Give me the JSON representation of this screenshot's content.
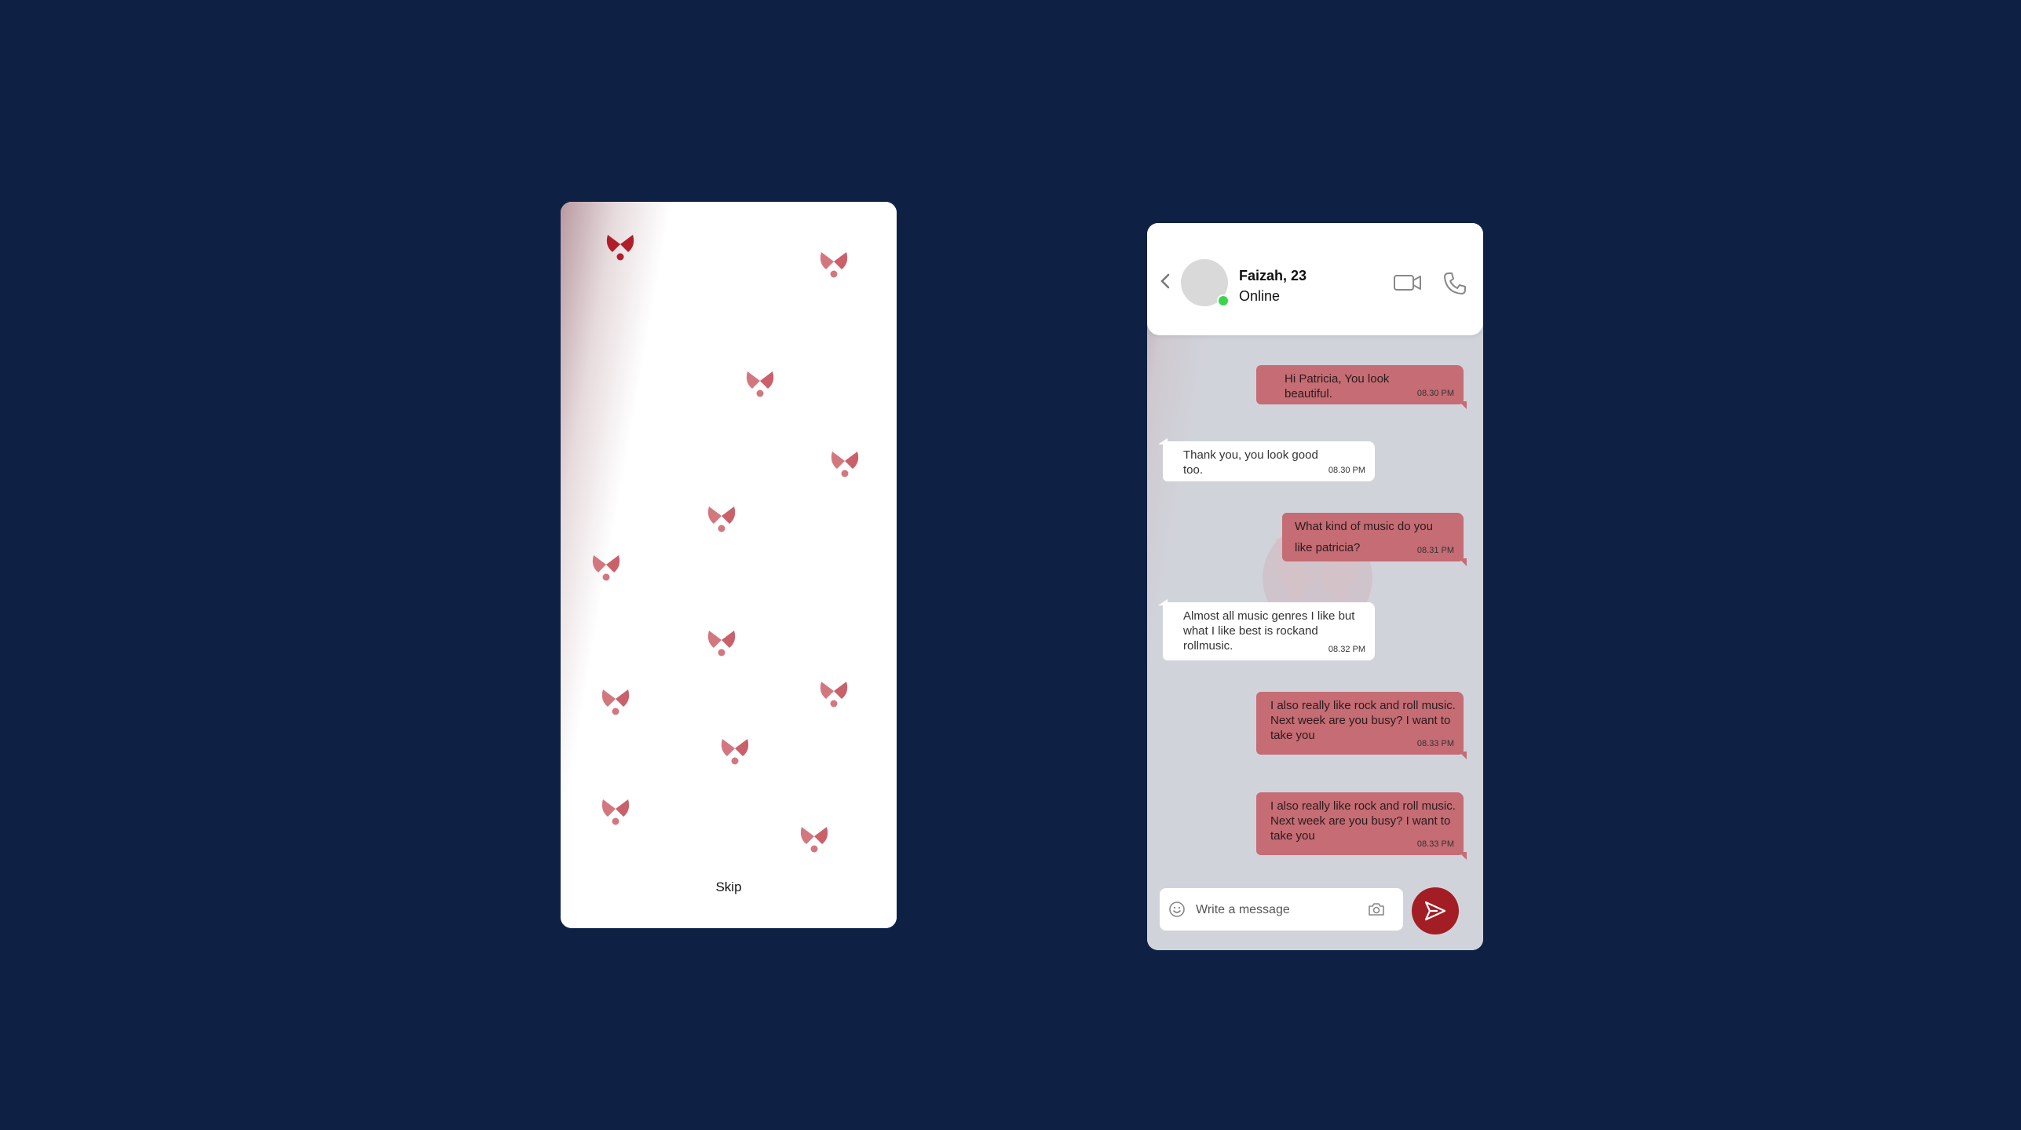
{
  "splash": {
    "skip_label": "Skip"
  },
  "chat": {
    "contact_name": "Faizah, 23",
    "status": "Online",
    "messages": [
      {
        "direction": "out",
        "text": "Hi Patricia, You look beautiful.",
        "time": "08.30 PM"
      },
      {
        "direction": "in",
        "text": "Thank you, you look good too.",
        "time": "08.30 PM"
      },
      {
        "direction": "out",
        "text": "What kind of music do you like patricia?",
        "time": "08.31 PM"
      },
      {
        "direction": "in",
        "text": "Almost all music genres I like but what I like best is rockand rollmusic.",
        "time": "08.32 PM"
      },
      {
        "direction": "out",
        "text": "I also really like rock and roll music. Next week are you busy? I want to take you",
        "time": "08.33 PM"
      },
      {
        "direction": "out",
        "text": "I also really like rock and roll music. Next week are you busy? I want to take you",
        "time": "08.33 PM"
      }
    ],
    "composer": {
      "placeholder": "Write a message"
    }
  },
  "colors": {
    "background": "#0e2145",
    "outgoing_bubble": "#c56c74",
    "send_button": "#a31d24",
    "online": "#3ad54a"
  },
  "icons": [
    "back-chevron-icon",
    "video-call-icon",
    "phone-call-icon",
    "emoji-icon",
    "camera-icon",
    "send-icon",
    "heart-logo-icon"
  ]
}
